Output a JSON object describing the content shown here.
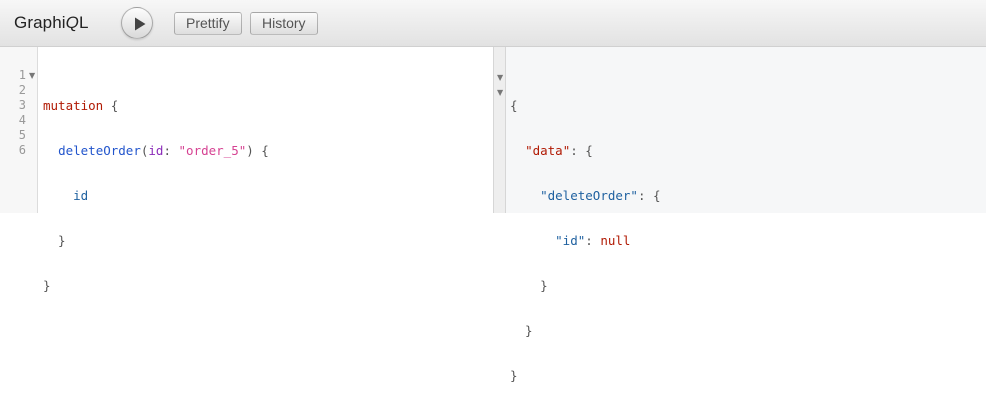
{
  "app": {
    "title_prefix": "Graphi",
    "title_italic": "Q",
    "title_suffix": "L"
  },
  "toolbar": {
    "run_icon": "play-icon",
    "prettify_label": "Prettify",
    "history_label": "History"
  },
  "editor": {
    "line_numbers": [
      "1",
      "2",
      "3",
      "4",
      "5",
      "6"
    ],
    "fold_marker": "▼",
    "tokens": {
      "l1_keyword": "mutation",
      "l1_brace": " {",
      "l2_indent": "  ",
      "l2_field": "deleteOrder",
      "l2_paren_open": "(",
      "l2_arg": "id",
      "l2_colon": ": ",
      "l2_value": "\"order_5\"",
      "l2_tail": ") {",
      "l3_indent": "    ",
      "l3_field": "id",
      "l4_text": "  }",
      "l5_text": "}"
    }
  },
  "result": {
    "fold_marker": "▼",
    "tokens": {
      "r1": "{",
      "r2_indent": "  ",
      "r2_key": "\"data\"",
      "r2_tail": ": {",
      "r3_indent": "    ",
      "r3_key": "\"deleteOrder\"",
      "r3_tail": ": {",
      "r4_indent": "      ",
      "r4_key": "\"id\"",
      "r4_colon": ": ",
      "r4_value": "null",
      "r5": "    }",
      "r6": "  }",
      "r7": "}"
    }
  },
  "colors": {
    "keyword": "#b11a04",
    "field": "#2255cc",
    "argument": "#8b2bb9",
    "string": "#d64292",
    "property": "#1f61a0"
  }
}
